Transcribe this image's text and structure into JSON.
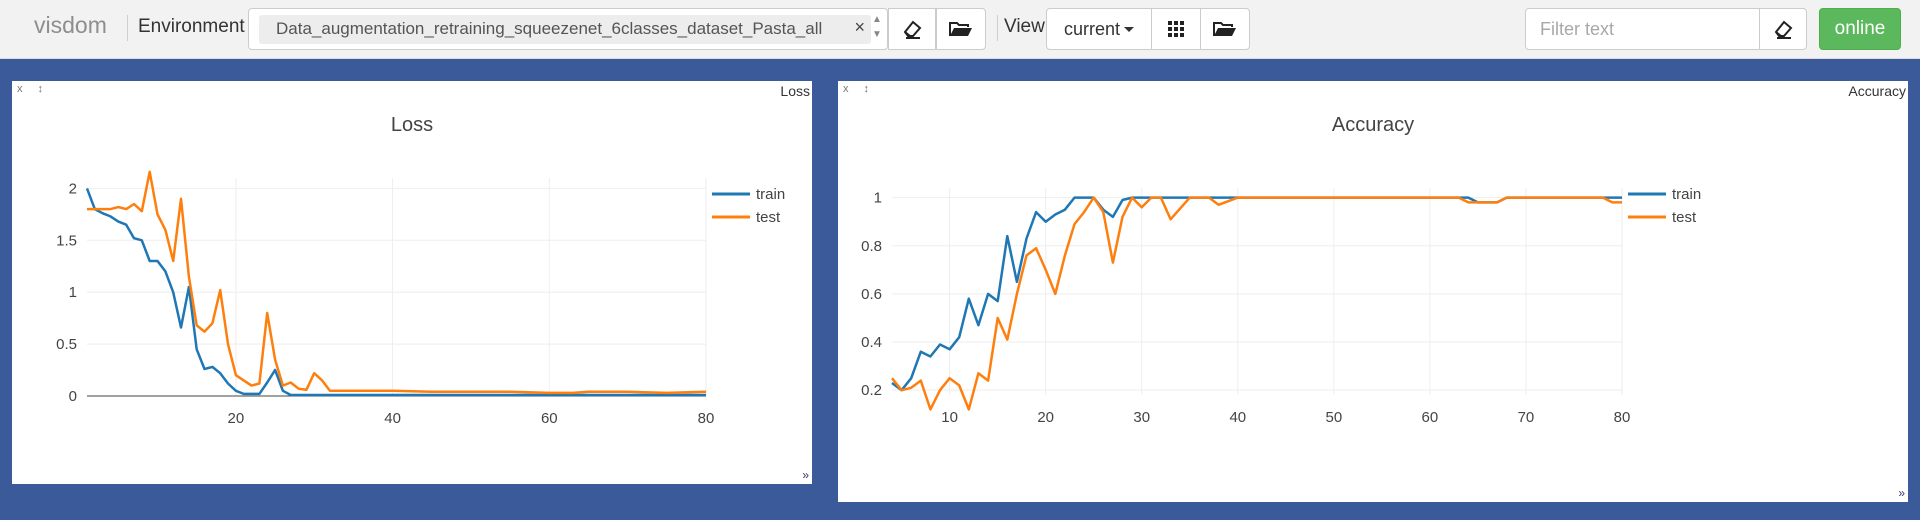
{
  "navbar": {
    "brand": "visdom",
    "environment_label": "Environment",
    "environment_value": "Data_augmentation_retraining_squeezenet_6classes_dataset_Pasta_all",
    "environment_chip_remove": "×",
    "view_label": "View",
    "view_value": "current",
    "filter_placeholder": "Filter text",
    "online_label": "online",
    "icons": [
      "eraser-icon",
      "folder-open-icon",
      "grid-icon",
      "folder-open-icon",
      "eraser-icon",
      "chevron-up-icon",
      "chevron-down-icon"
    ]
  },
  "panes": {
    "loss": {
      "label": "Loss",
      "controls": "x ↕"
    },
    "accuracy": {
      "label": "Accuracy",
      "controls": "x ↕"
    }
  },
  "colors": {
    "train": "#1f77b4",
    "test": "#ff7f0e",
    "background": "#3b5a99",
    "online": "#5cb85c"
  },
  "chart_data": [
    {
      "type": "line",
      "title": "Loss",
      "xlabel": "",
      "ylabel": "",
      "xlim": [
        1,
        80
      ],
      "ylim": [
        0,
        2.1
      ],
      "x_ticks": [
        20,
        40,
        60,
        80
      ],
      "y_ticks": [
        0,
        0.5,
        1,
        1.5,
        2
      ],
      "legend_position": "top-right",
      "grid": true,
      "series": [
        {
          "name": "train",
          "color": "#1f77b4",
          "x": [
            1,
            2,
            3,
            4,
            5,
            6,
            7,
            8,
            9,
            10,
            11,
            12,
            13,
            14,
            15,
            16,
            17,
            18,
            19,
            20,
            21,
            22,
            23,
            24,
            25,
            26,
            27,
            28,
            29,
            30,
            35,
            40,
            45,
            50,
            55,
            60,
            65,
            70,
            75,
            80
          ],
          "y": [
            2.0,
            1.8,
            1.76,
            1.73,
            1.68,
            1.65,
            1.52,
            1.5,
            1.3,
            1.3,
            1.2,
            1.0,
            0.66,
            1.05,
            0.45,
            0.26,
            0.28,
            0.22,
            0.12,
            0.05,
            0.02,
            0.02,
            0.02,
            0.13,
            0.25,
            0.05,
            0.01,
            0.01,
            0.01,
            0.01,
            0.01,
            0.01,
            0.01,
            0.01,
            0.01,
            0.01,
            0.01,
            0.01,
            0.01,
            0.01
          ]
        },
        {
          "name": "test",
          "color": "#ff7f0e",
          "x": [
            1,
            2,
            3,
            4,
            5,
            6,
            7,
            8,
            9,
            10,
            11,
            12,
            13,
            14,
            15,
            16,
            17,
            18,
            19,
            20,
            21,
            22,
            23,
            24,
            25,
            26,
            27,
            28,
            29,
            30,
            31,
            32,
            35,
            40,
            45,
            50,
            55,
            60,
            63,
            65,
            70,
            75,
            80
          ],
          "y": [
            1.8,
            1.8,
            1.8,
            1.8,
            1.82,
            1.8,
            1.85,
            1.78,
            2.16,
            1.75,
            1.6,
            1.3,
            1.9,
            1.15,
            0.68,
            0.62,
            0.7,
            1.02,
            0.5,
            0.2,
            0.15,
            0.1,
            0.12,
            0.8,
            0.35,
            0.1,
            0.13,
            0.07,
            0.06,
            0.22,
            0.15,
            0.05,
            0.05,
            0.05,
            0.04,
            0.04,
            0.04,
            0.03,
            0.03,
            0.04,
            0.04,
            0.03,
            0.04
          ]
        }
      ]
    },
    {
      "type": "line",
      "title": "Accuracy",
      "xlabel": "",
      "ylabel": "",
      "xlim": [
        4,
        80
      ],
      "ylim": [
        0.18,
        1.04
      ],
      "x_ticks": [
        10,
        20,
        30,
        40,
        50,
        60,
        70,
        80
      ],
      "y_ticks": [
        0.2,
        0.4,
        0.6,
        0.8,
        1
      ],
      "legend_position": "top-right",
      "grid": true,
      "series": [
        {
          "name": "train",
          "color": "#1f77b4",
          "x": [
            4,
            5,
            6,
            7,
            8,
            9,
            10,
            11,
            12,
            13,
            14,
            15,
            16,
            17,
            18,
            19,
            20,
            21,
            22,
            23,
            24,
            25,
            26,
            27,
            28,
            29,
            30,
            35,
            40,
            45,
            50,
            55,
            60,
            64,
            65,
            66,
            67,
            68,
            70,
            75,
            80
          ],
          "y": [
            0.23,
            0.2,
            0.25,
            0.36,
            0.34,
            0.39,
            0.37,
            0.42,
            0.58,
            0.47,
            0.6,
            0.57,
            0.84,
            0.65,
            0.83,
            0.94,
            0.9,
            0.93,
            0.95,
            1.0,
            1.0,
            1.0,
            0.95,
            0.92,
            0.99,
            1.0,
            1.0,
            1.0,
            1.0,
            1.0,
            1.0,
            1.0,
            1.0,
            1.0,
            0.98,
            0.98,
            0.98,
            1.0,
            1.0,
            1.0,
            1.0
          ]
        },
        {
          "name": "test",
          "color": "#ff7f0e",
          "x": [
            4,
            5,
            6,
            7,
            8,
            9,
            10,
            11,
            12,
            13,
            14,
            15,
            16,
            17,
            18,
            19,
            20,
            21,
            22,
            23,
            24,
            25,
            26,
            27,
            28,
            29,
            30,
            31,
            32,
            33,
            35,
            36,
            37,
            38,
            40,
            45,
            50,
            55,
            60,
            63,
            64,
            65,
            66,
            67,
            68,
            70,
            75,
            78,
            79,
            80
          ],
          "y": [
            0.25,
            0.2,
            0.21,
            0.24,
            0.12,
            0.2,
            0.25,
            0.22,
            0.12,
            0.27,
            0.24,
            0.5,
            0.41,
            0.6,
            0.76,
            0.79,
            0.7,
            0.6,
            0.76,
            0.89,
            0.94,
            1.0,
            0.94,
            0.73,
            0.92,
            1.0,
            0.96,
            1.0,
            1.0,
            0.91,
            1.0,
            1.0,
            1.0,
            0.97,
            1.0,
            1.0,
            1.0,
            1.0,
            1.0,
            1.0,
            0.98,
            0.98,
            0.98,
            0.98,
            1.0,
            1.0,
            1.0,
            1.0,
            0.98,
            0.98
          ]
        }
      ]
    }
  ]
}
